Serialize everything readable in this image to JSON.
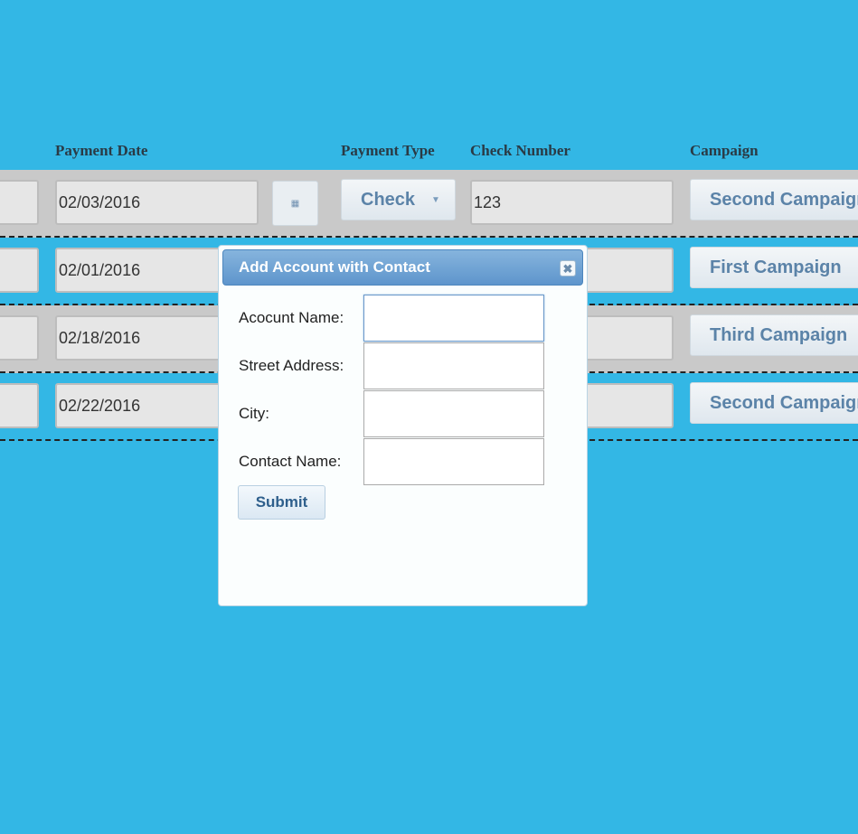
{
  "table": {
    "headers": {
      "payment_date": "Payment Date",
      "payment_type": "Payment Type",
      "check_number": "Check Number",
      "campaign": "Campaign"
    },
    "rows": [
      {
        "payment_date": "02/03/2016",
        "payment_type": "Check",
        "check_number": "123",
        "campaign": "Second Campaign"
      },
      {
        "payment_date": "02/01/2016",
        "campaign": "First Campaign"
      },
      {
        "payment_date": "02/18/2016",
        "campaign": "Third Campaign"
      },
      {
        "payment_date": "02/22/2016",
        "campaign": "Second Campaign"
      }
    ]
  },
  "dialog": {
    "title": "Add Account with Contact",
    "fields": {
      "account_name": {
        "label": "Acocunt Name:",
        "value": ""
      },
      "street_address": {
        "label": "Street Address:",
        "value": ""
      },
      "city": {
        "label": "City:",
        "value": ""
      },
      "contact_name": {
        "label": "Contact Name:",
        "value": ""
      }
    },
    "submit_label": "Submit",
    "close_icon": "close-icon"
  },
  "colors": {
    "background": "#33b7e5",
    "dialog_title": "#6a9fd2",
    "campaign_text": "#5b83a8"
  }
}
